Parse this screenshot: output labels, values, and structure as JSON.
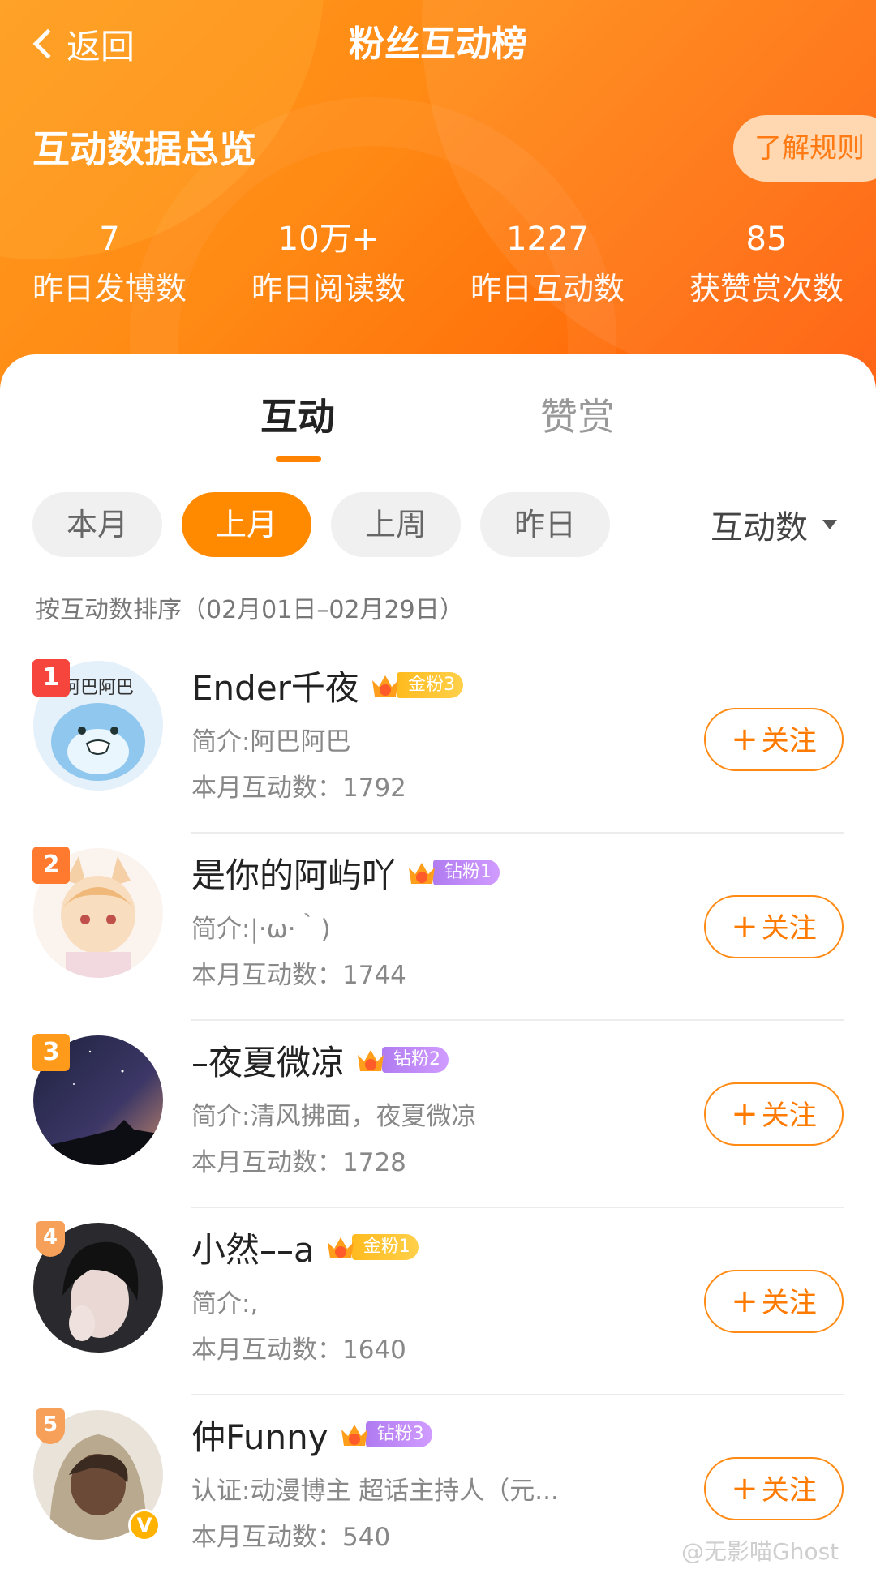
{
  "nav": {
    "back_label": "返回",
    "title": "粉丝互动榜"
  },
  "overview": {
    "title": "互动数据总览",
    "rules_label": "了解规则",
    "stats": [
      {
        "value": "7",
        "label": "昨日发博数"
      },
      {
        "value": "10万+",
        "label": "昨日阅读数"
      },
      {
        "value": "1227",
        "label": "昨日互动数"
      },
      {
        "value": "85",
        "label": "获赞赏次数"
      }
    ]
  },
  "tabs": [
    {
      "label": "互动",
      "active": true
    },
    {
      "label": "赞赏",
      "active": false
    }
  ],
  "filters": {
    "chips": [
      "本月",
      "上月",
      "上周",
      "昨日"
    ],
    "active": "上月",
    "sort_label": "互动数",
    "description": "按互动数排序（02月01日–02月29日）"
  },
  "fans": [
    {
      "rank": "1",
      "name": "Ender千夜",
      "badge_level": "2",
      "badge_label": "金粉3",
      "badge_type": "gold",
      "bio": "简介:阿巴阿巴",
      "count_label": "本月互动数：",
      "count": "1792",
      "follow_label": "关注"
    },
    {
      "rank": "2",
      "name": "是你的阿屿吖",
      "badge_level": "5",
      "badge_label": "钻粉1",
      "badge_type": "diamond",
      "bio": "简介:|·ω·｀)",
      "count_label": "本月互动数：",
      "count": "1744",
      "follow_label": "关注"
    },
    {
      "rank": "3",
      "name": "–夜夏微凉",
      "badge_level": "7",
      "badge_label": "钻粉2",
      "badge_type": "diamond",
      "bio": "简介:清风拂面，夜夏微凉",
      "count_label": "本月互动数：",
      "count": "1728",
      "follow_label": "关注"
    },
    {
      "rank": "4",
      "name": "小然––a",
      "badge_level": "2",
      "badge_label": "金粉1",
      "badge_type": "gold",
      "bio": "简介:,",
      "count_label": "本月互动数：",
      "count": "1640",
      "follow_label": "关注"
    },
    {
      "rank": "5",
      "name": "仲Funny",
      "badge_level": "6",
      "badge_label": "钻粉3",
      "badge_type": "diamond",
      "bio": "认证:动漫博主 超话主持人（元...",
      "count_label": "本月互动数：",
      "count": "540",
      "follow_label": "关注"
    }
  ],
  "watermark": "@无影喵Ghost",
  "colors": {
    "accent": "#ff8a00",
    "rank1": "#f5453c",
    "gold_badge": "#ffbb1f",
    "diamond_badge": "#b07bf0"
  }
}
